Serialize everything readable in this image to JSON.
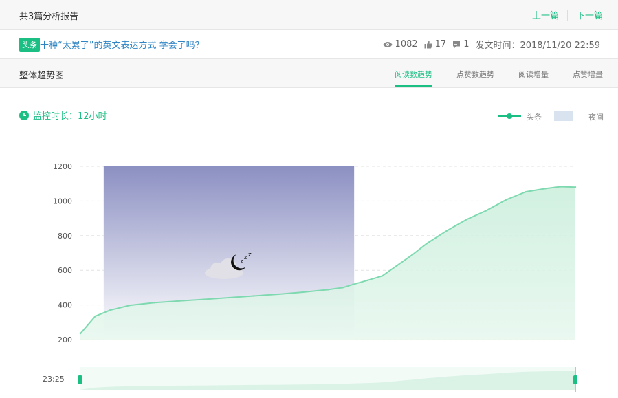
{
  "topbar": {
    "count_text": "共3篇分析报告",
    "prev": "上一篇",
    "next": "下一篇"
  },
  "article": {
    "badge": "头条",
    "title": "十种“太累了”的英文表达方式 学会了吗？",
    "views": "1082",
    "likes": "17",
    "comments": "1",
    "publish_time": "发文时间：2018/11/20 22:59"
  },
  "section": {
    "label": "整体趋势图",
    "tabs": [
      {
        "label": "阅读数趋势",
        "active": true
      },
      {
        "label": "点赞数趋势",
        "active": false
      },
      {
        "label": "阅读增量",
        "active": false
      },
      {
        "label": "点赞增量",
        "active": false
      }
    ]
  },
  "monitor": {
    "text": "监控时长：12小时"
  },
  "legend": {
    "series_label": "头条",
    "night_label": "夜间"
  },
  "slider": {
    "start_label": "23:25"
  },
  "colors": {
    "accent": "#1bbf84",
    "line": "#7fd9b0",
    "fill": "#d4f2e3",
    "night_top": "#8c90c2",
    "night_bottom": "#ffffff",
    "link": "#2f84c4"
  },
  "icons": {
    "views": "eye-icon",
    "likes": "thumb-up-icon",
    "comments": "comment-icon",
    "monitor": "clock-icon",
    "night": "moon-cloud-icon"
  },
  "chart_data": {
    "type": "area",
    "y_ticks": [
      200,
      400,
      600,
      800,
      1000,
      1200
    ],
    "ylim": [
      200,
      1200
    ],
    "xlim": [
      0,
      1
    ],
    "grid": true,
    "night_band": [
      0.047,
      0.553
    ],
    "series": [
      {
        "name": "头条",
        "x": [
          0,
          0.03,
          0.06,
          0.1,
          0.15,
          0.2,
          0.25,
          0.3,
          0.35,
          0.4,
          0.45,
          0.5,
          0.53,
          0.55,
          0.58,
          0.61,
          0.64,
          0.67,
          0.7,
          0.74,
          0.78,
          0.82,
          0.86,
          0.9,
          0.94,
          0.97,
          1.0
        ],
        "y": [
          235,
          335,
          370,
          398,
          413,
          423,
          432,
          442,
          452,
          462,
          474,
          488,
          500,
          518,
          542,
          568,
          628,
          688,
          755,
          828,
          893,
          945,
          1007,
          1053,
          1072,
          1083,
          1080
        ]
      }
    ]
  }
}
